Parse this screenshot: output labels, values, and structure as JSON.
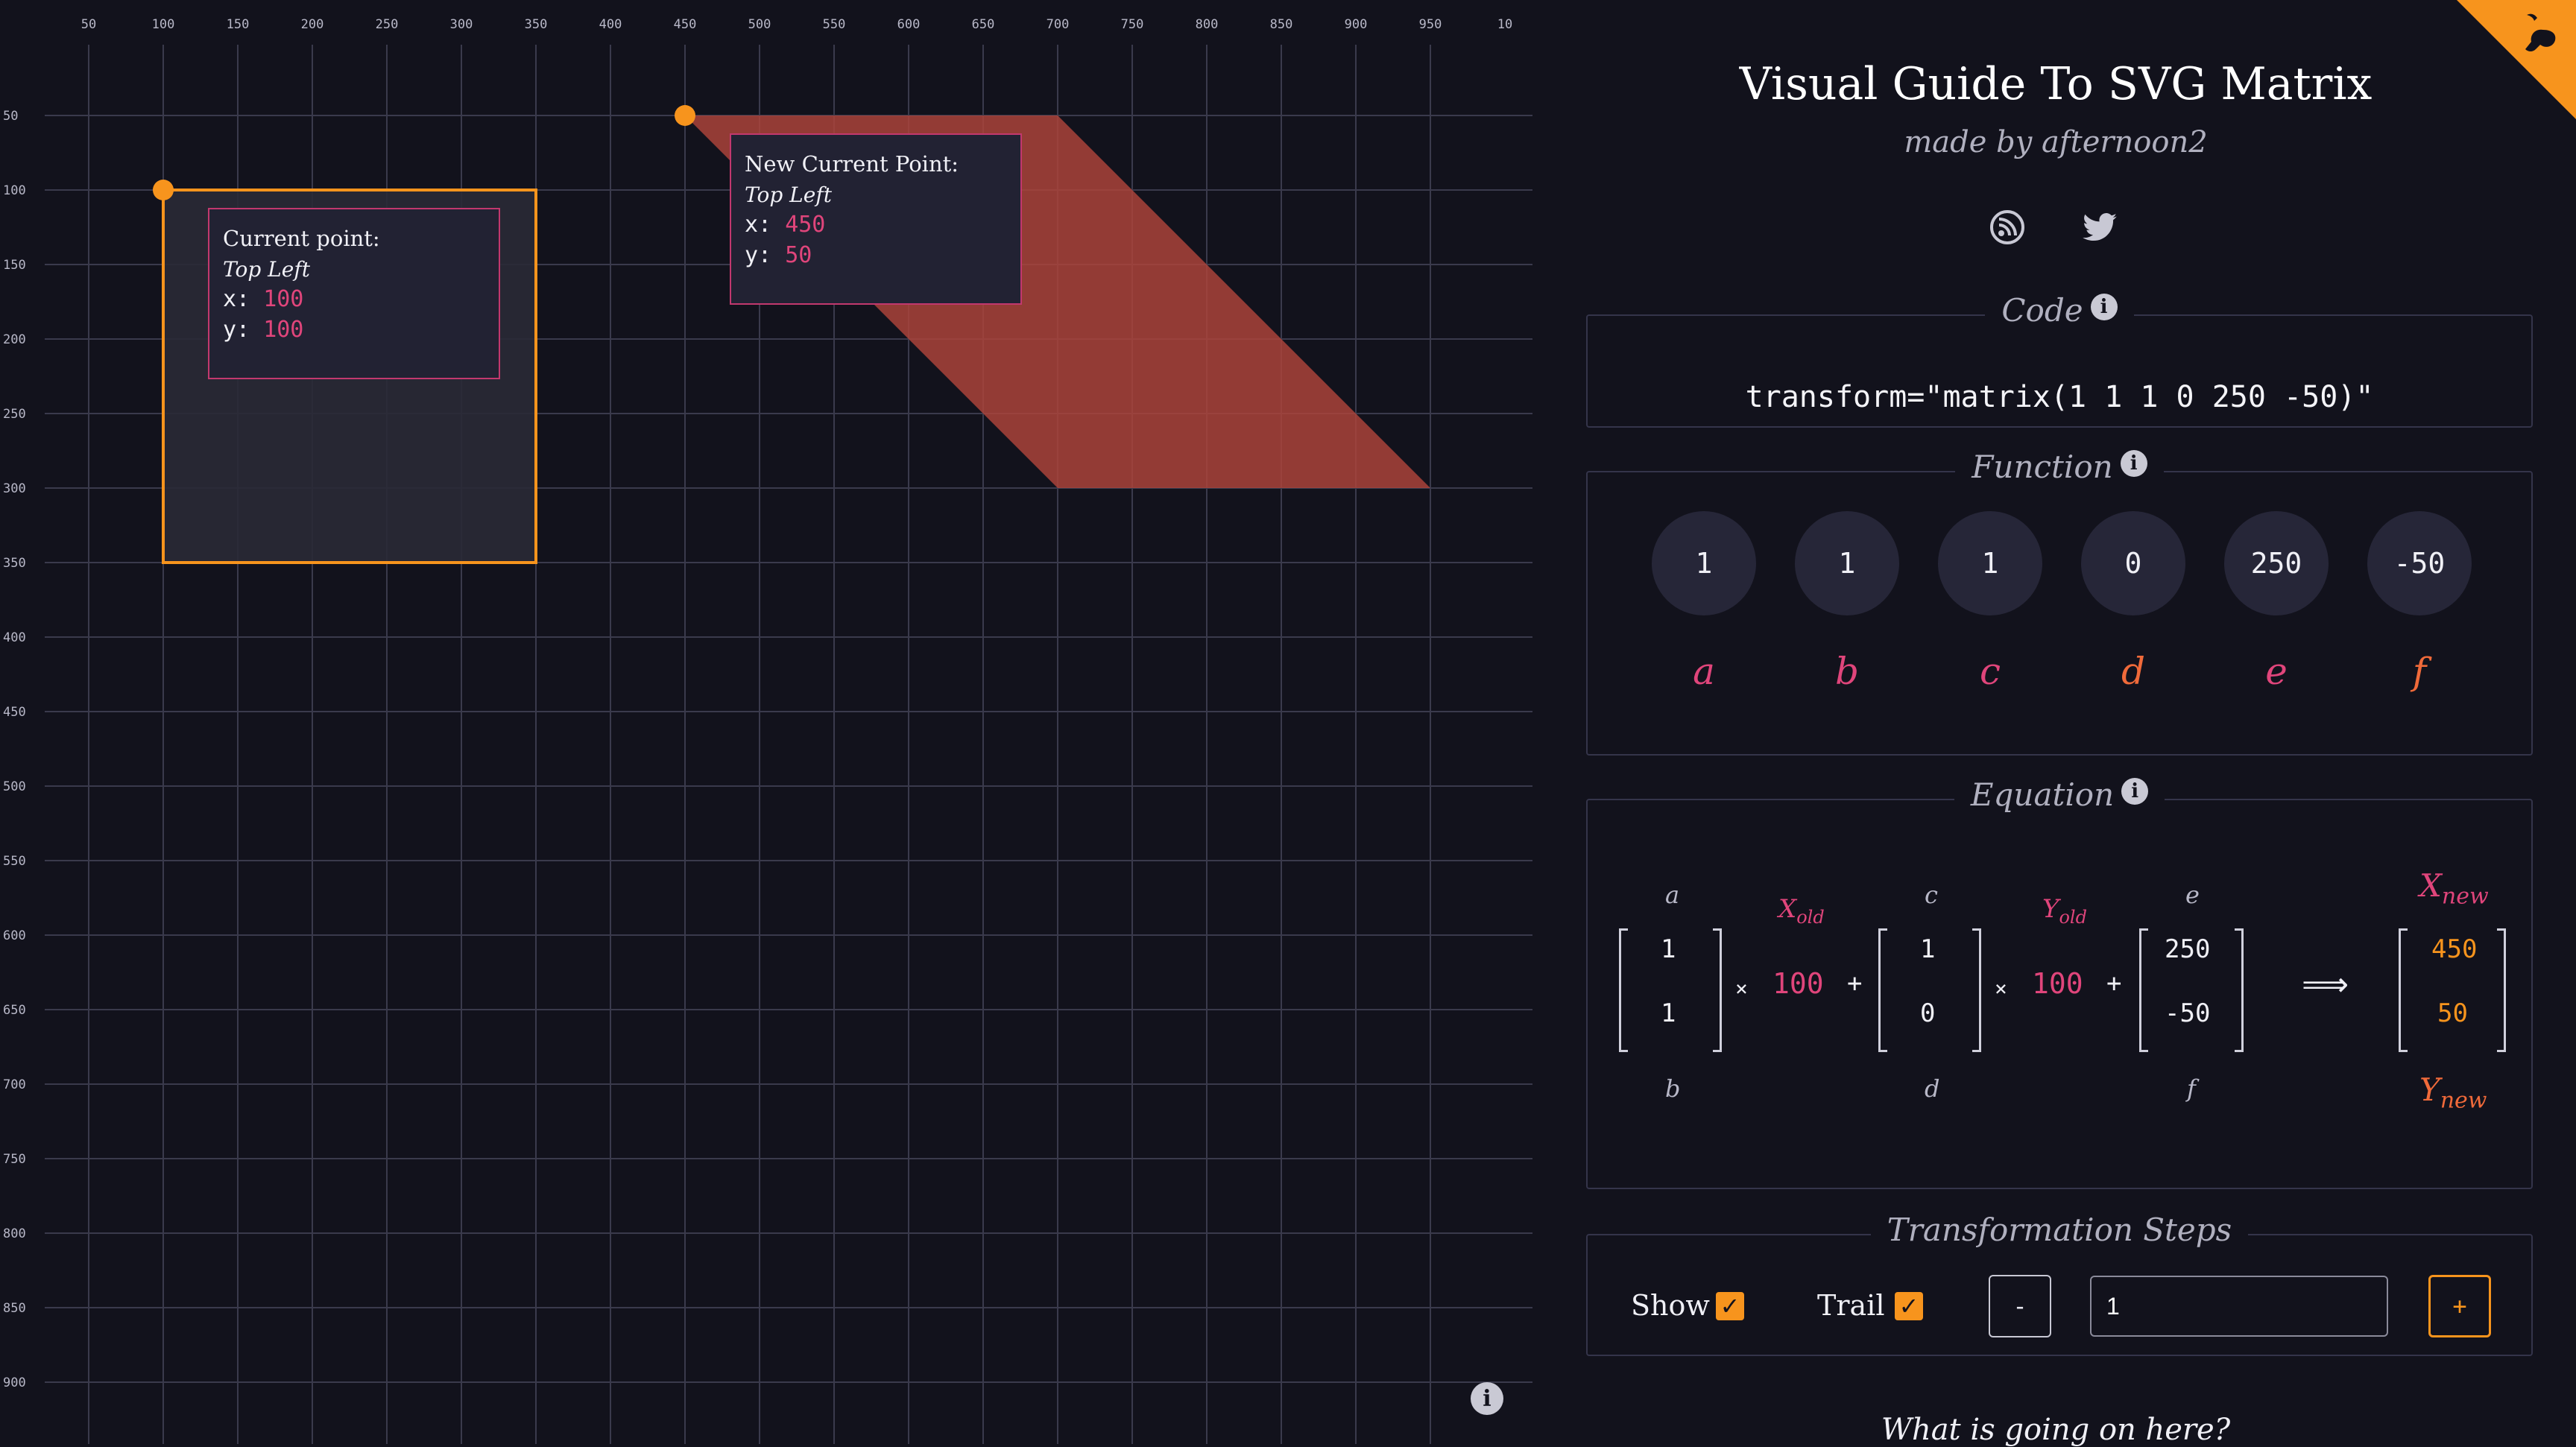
{
  "canvas": {
    "x_ticks": [
      "50",
      "100",
      "150",
      "200",
      "250",
      "300",
      "350",
      "400",
      "450",
      "500",
      "550",
      "600",
      "650",
      "700",
      "750",
      "800",
      "850",
      "900",
      "950",
      "10"
    ],
    "y_ticks": [
      "50",
      "100",
      "150",
      "200",
      "250",
      "300",
      "350",
      "400",
      "450",
      "500",
      "550",
      "600",
      "650",
      "700",
      "750",
      "800",
      "850",
      "900"
    ],
    "original_rect": {
      "label": "Current point:",
      "corner": "Top Left",
      "x_label": "x:",
      "x": "100",
      "y_label": "y:",
      "y": "100"
    },
    "transformed": {
      "label": "New Current Point:",
      "corner": "Top Left",
      "x_label": "x:",
      "x": "450",
      "y_label": "y:",
      "y": "50"
    },
    "info_icon": "info-icon",
    "colors": {
      "accent": "#f7941d",
      "shape": "#b0443a",
      "tooltip_border": "#c2386e",
      "value": "#e0457b"
    }
  },
  "header": {
    "title": "Visual Guide To SVG Matrix",
    "subtitle": "made by afternoon2",
    "social": [
      "blog-icon",
      "twitter-icon"
    ],
    "corner_icon": "github-icon"
  },
  "code": {
    "legend": "Code",
    "text": "transform=\"matrix(1 1 1 0 250 -50)\""
  },
  "function": {
    "legend": "Function",
    "params": [
      {
        "value": "1",
        "letter": "a"
      },
      {
        "value": "1",
        "letter": "b"
      },
      {
        "value": "1",
        "letter": "c"
      },
      {
        "value": "0",
        "letter": "d"
      },
      {
        "value": "250",
        "letter": "e"
      },
      {
        "value": "-50",
        "letter": "f"
      }
    ]
  },
  "equation": {
    "legend": "Equation",
    "col1": {
      "top": "a",
      "v1": "1",
      "v2": "1",
      "bottom": "b"
    },
    "xold": {
      "label": "X",
      "sub": "old",
      "value": "100"
    },
    "col2": {
      "top": "c",
      "v1": "1",
      "v2": "0",
      "bottom": "d"
    },
    "yold": {
      "label": "Y",
      "sub": "old",
      "value": "100"
    },
    "col3": {
      "top": "e",
      "v1": "250",
      "v2": "-50",
      "bottom": "f"
    },
    "times": "×",
    "plus": "+",
    "implies": "⟹",
    "result": {
      "xlabel": "X",
      "xsub": "new",
      "x": "450",
      "y": "50",
      "ylabel": "Y",
      "ysub": "new"
    }
  },
  "steps": {
    "legend": "Transformation Steps",
    "show_label": "Show",
    "show_checked": true,
    "trail_label": "Trail",
    "trail_checked": true,
    "minus": "-",
    "value": "1",
    "plus": "+"
  },
  "footer": {
    "question": "What is going on here?"
  }
}
